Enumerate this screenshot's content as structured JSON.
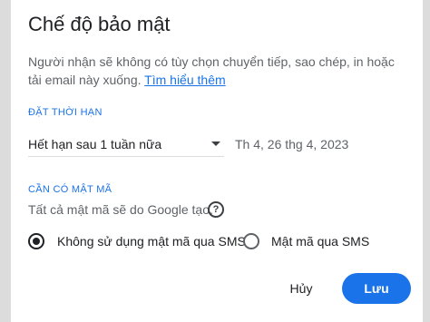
{
  "dialog": {
    "title": "Chế độ bảo mật",
    "description": "Người nhận sẽ không có tùy chọn chuyển tiếp, sao chép, in hoặc tải email này xuống.",
    "learn_more": "Tìm hiểu thêm"
  },
  "expiry": {
    "section_label": "ĐẶT THỜI HẠN",
    "selected": "Hết hạn sau 1 tuần nữa",
    "date": "Th 4, 26 thg 4, 2023"
  },
  "passcode": {
    "section_label": "CẦN CÓ MẬT MÃ",
    "note": "Tất cả mật mã sẽ do Google tạo.",
    "help_icon": "help-circle-icon",
    "options": [
      {
        "label": "Không sử dụng mật mã qua SMS",
        "checked": true
      },
      {
        "label": "Mật mã qua SMS",
        "checked": false
      }
    ]
  },
  "actions": {
    "cancel": "Hủy",
    "save": "Lưu"
  },
  "colors": {
    "accent": "#1a73e8",
    "text": "#202124",
    "muted": "#5f6368"
  }
}
